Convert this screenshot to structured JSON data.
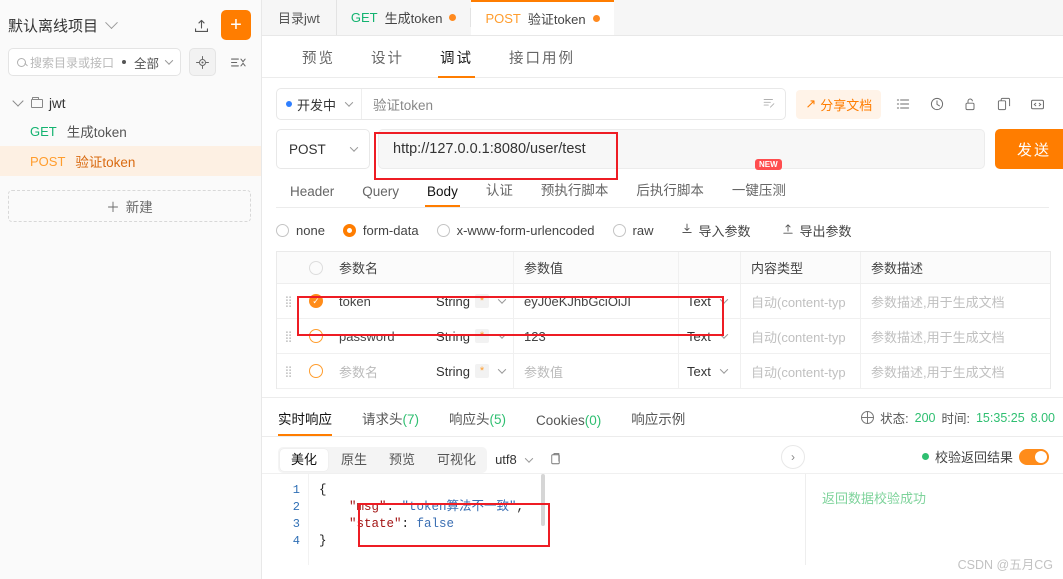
{
  "sidebar": {
    "project_name": "默认离线项目",
    "upload_icon": "upload-icon",
    "add_label": "+",
    "search_placeholder": "搜索目录或接口",
    "filter_label": "全部",
    "locate_icon": "target-icon",
    "sort_icon": "sort-icon",
    "tree": {
      "folder_name": "jwt",
      "items": [
        {
          "method": "GET",
          "name": "生成token",
          "active": false
        },
        {
          "method": "POST",
          "name": "验证token",
          "active": true
        }
      ]
    },
    "new_label": "新建"
  },
  "tabbar": {
    "dir_label": "目录jwt",
    "tabs": [
      {
        "method": "GET",
        "name": "生成token",
        "active": false,
        "dirty": true
      },
      {
        "method": "POST",
        "name": "验证token",
        "active": true,
        "dirty": true
      }
    ]
  },
  "subtabs": [
    {
      "label": "预览",
      "active": false
    },
    {
      "label": "设计",
      "active": false
    },
    {
      "label": "调试",
      "active": true
    },
    {
      "label": "接口用例",
      "active": false
    }
  ],
  "env": {
    "env_name": "开发中",
    "api_name": "验证token",
    "share_label": "分享文档",
    "toolbar_icons": [
      "list-icon",
      "clock-icon",
      "lock-icon",
      "copy-icon",
      "code-icon"
    ]
  },
  "request": {
    "method": "POST",
    "url": "http://127.0.0.1:8080/user/test",
    "send_label": "发送",
    "tabs": [
      {
        "label": "Header",
        "active": false
      },
      {
        "label": "Query",
        "active": false
      },
      {
        "label": "Body",
        "active": true
      },
      {
        "label": "认证",
        "active": false
      },
      {
        "label": "预执行脚本",
        "active": false
      },
      {
        "label": "后执行脚本",
        "active": false
      },
      {
        "label": "一键压测",
        "active": false,
        "badge": "NEW"
      }
    ],
    "body_types": [
      {
        "label": "none",
        "selected": false
      },
      {
        "label": "form-data",
        "selected": true
      },
      {
        "label": "x-www-form-urlencoded",
        "selected": false
      },
      {
        "label": "raw",
        "selected": false
      }
    ],
    "import_label": "导入参数",
    "export_label": "导出参数",
    "table": {
      "headers": [
        "参数名",
        "参数值",
        "内容类型",
        "参数描述"
      ],
      "rows": [
        {
          "checked": true,
          "name": "token",
          "name_placeholder": false,
          "type": "String",
          "required": "*",
          "value": "eyJ0eKJhbGciOiJI",
          "value_placeholder": false,
          "content_mode": "Text",
          "content_type": "自动(content-typ",
          "description": "参数描述,用于生成文档"
        },
        {
          "checked": false,
          "name": "password",
          "name_placeholder": false,
          "type": "String",
          "required": "*",
          "value": "123",
          "value_placeholder": false,
          "content_mode": "Text",
          "content_type": "自动(content-typ",
          "description": "参数描述,用于生成文档"
        },
        {
          "checked": false,
          "name": "参数名",
          "name_placeholder": true,
          "type": "String",
          "required": "*",
          "value": "参数值",
          "value_placeholder": true,
          "content_mode": "Text",
          "content_type": "自动(content-typ",
          "description": "参数描述,用于生成文档"
        }
      ]
    }
  },
  "response": {
    "tabs": [
      {
        "label": "实时响应",
        "count": "",
        "active": true
      },
      {
        "label": "请求头",
        "count": "(7)",
        "active": false
      },
      {
        "label": "响应头",
        "count": "(5)",
        "active": false
      },
      {
        "label": "Cookies",
        "count": "(0)",
        "active": false
      },
      {
        "label": "响应示例",
        "count": "",
        "active": false
      }
    ],
    "status_label": "状态:",
    "status_value": "200",
    "time_label": "时间:",
    "time_value": "15:35:25",
    "size_value": "8.00",
    "formats": [
      {
        "label": "美化",
        "active": true
      },
      {
        "label": "原生",
        "active": false
      },
      {
        "label": "预览",
        "active": false
      },
      {
        "label": "可视化",
        "active": false
      }
    ],
    "encoding": "utf8",
    "copy_icon": "copy-icon",
    "verify_label": "校验返回结果",
    "verify_on": true,
    "line_numbers": [
      "1",
      "2",
      "3",
      "4"
    ],
    "code_lines": [
      {
        "open": "{"
      },
      {
        "key": "\"msg\"",
        "colon": ": ",
        "value": "\"token算法不一致\"",
        "comma": ","
      },
      {
        "key": "\"state\"",
        "colon": ": ",
        "value": "false",
        "comma": ""
      },
      {
        "close": "}"
      }
    ],
    "verify_result": "返回数据校验成功"
  },
  "watermark": "CSDN @五月CG",
  "colors": {
    "accent": "#ff7d00",
    "green": "#2fbf71",
    "highlight": "#ee1c24"
  }
}
